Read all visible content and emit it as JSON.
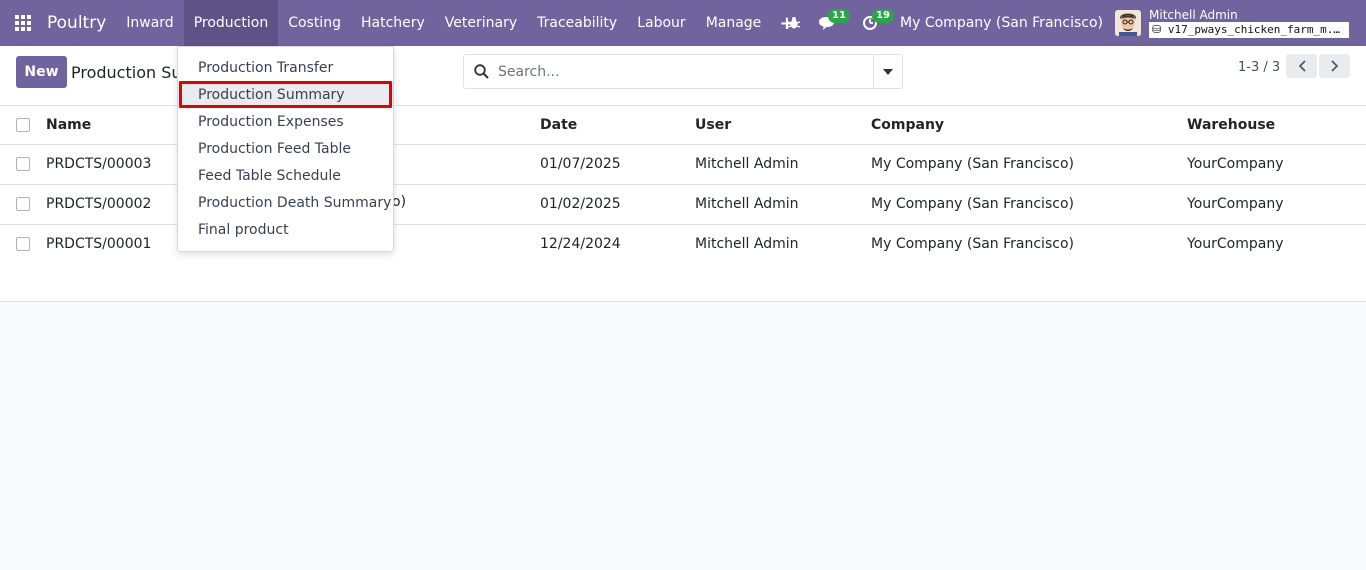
{
  "navbar": {
    "brand": "Poultry",
    "menu": [
      "Inward",
      "Production",
      "Costing",
      "Hatchery",
      "Veterinary",
      "Traceability",
      "Labour",
      "Manage"
    ],
    "active_menu": "Production",
    "plus_label": "+",
    "messages_count": "11",
    "activities_count": "19",
    "company": "My Company (San Francisco)",
    "user_name": "Mitchell Admin",
    "db_name": "v17_pways_chicken_farm_m..."
  },
  "dropdown": {
    "items": [
      "Production Transfer",
      "Production Summary",
      "Production Expenses",
      "Production Feed Table",
      "Feed Table Schedule",
      "Production Death Summary",
      "Final product"
    ],
    "highlighted": "Production Summary"
  },
  "control_panel": {
    "new_label": "New",
    "title": "Production Su",
    "search_placeholder": "Search...",
    "pager": "1-3 / 3"
  },
  "table": {
    "columns": [
      "Name",
      "Date",
      "User",
      "Company",
      "Warehouse"
    ],
    "rows": [
      {
        "name": "PRDCTS/00003",
        "date": "01/07/2025",
        "user": "Mitchell Admin",
        "company": "My Company (San Francisco)",
        "warehouse": "YourCompany"
      },
      {
        "name": "PRDCTS/00002",
        "date": "01/02/2025",
        "user": "Mitchell Admin",
        "company": "My Company (San Francisco)",
        "warehouse": "YourCompany"
      },
      {
        "name": "PRDCTS/00001",
        "date": "12/24/2024",
        "user": "Mitchell Admin",
        "company": "My Company (San Francisco)",
        "warehouse": "YourCompany"
      }
    ],
    "row2_partial_text": "o)"
  },
  "colors": {
    "navbar": "#71639e",
    "badge": "#28a745",
    "highlight_border": "#e60000"
  }
}
